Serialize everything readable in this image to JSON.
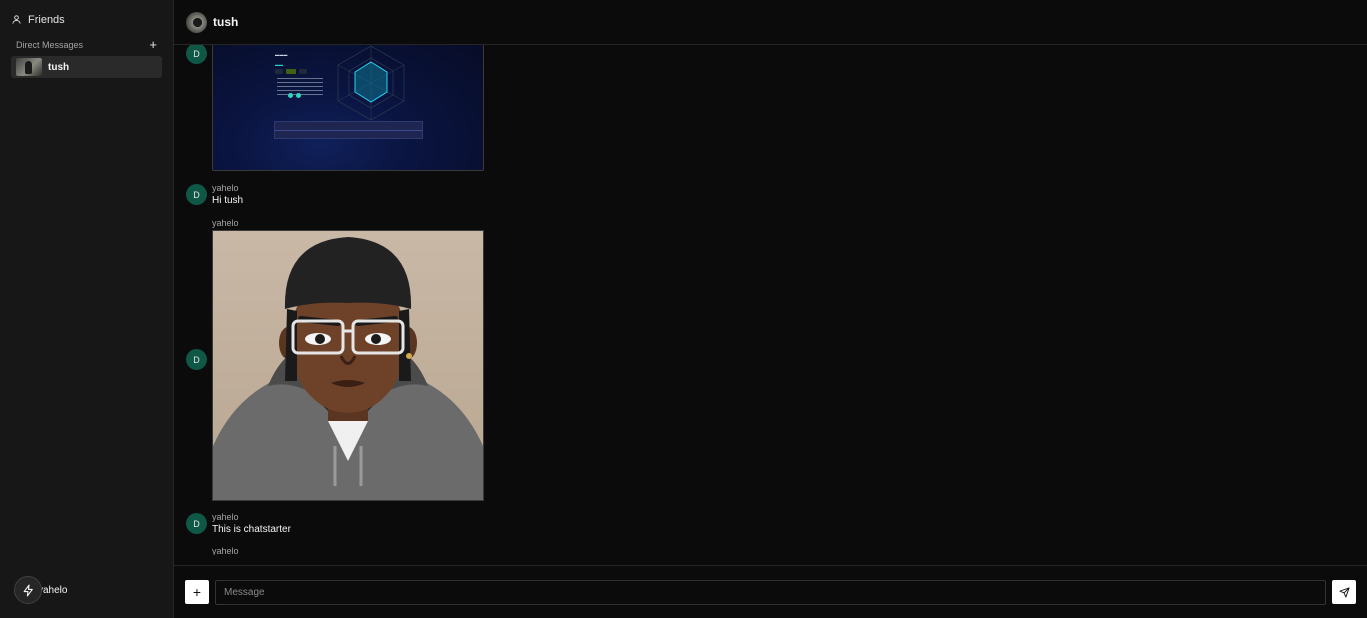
{
  "sidebar": {
    "friends_label": "Friends",
    "dm_section_label": "Direct Messages",
    "dm_add_icon": "plus-icon",
    "dms": [
      {
        "name": "tush"
      }
    ],
    "current_user": {
      "name": "yahelo",
      "icon": "bolt-icon"
    }
  },
  "channel": {
    "title": "tush"
  },
  "messages": [
    {
      "avatar_initial": "D",
      "type": "image",
      "image": "screenshot-radar-chart"
    },
    {
      "avatar_initial": "D",
      "author": "yahelo",
      "text": "Hi tush"
    },
    {
      "avatar_initial": "D",
      "author": "yahelo",
      "type": "image",
      "image": "cartoon-portrait"
    },
    {
      "avatar_initial": "D",
      "author": "yahelo",
      "text": "This is chatstarter"
    },
    {
      "author": "yahelo"
    }
  ],
  "composer": {
    "placeholder": "Message",
    "attach_icon": "plus-icon",
    "send_icon": "send-icon"
  },
  "colors": {
    "background": "#0b0b0b",
    "sidebar": "#171717",
    "avatar": "#0f5747",
    "selected_item": "#2a2a2a"
  }
}
